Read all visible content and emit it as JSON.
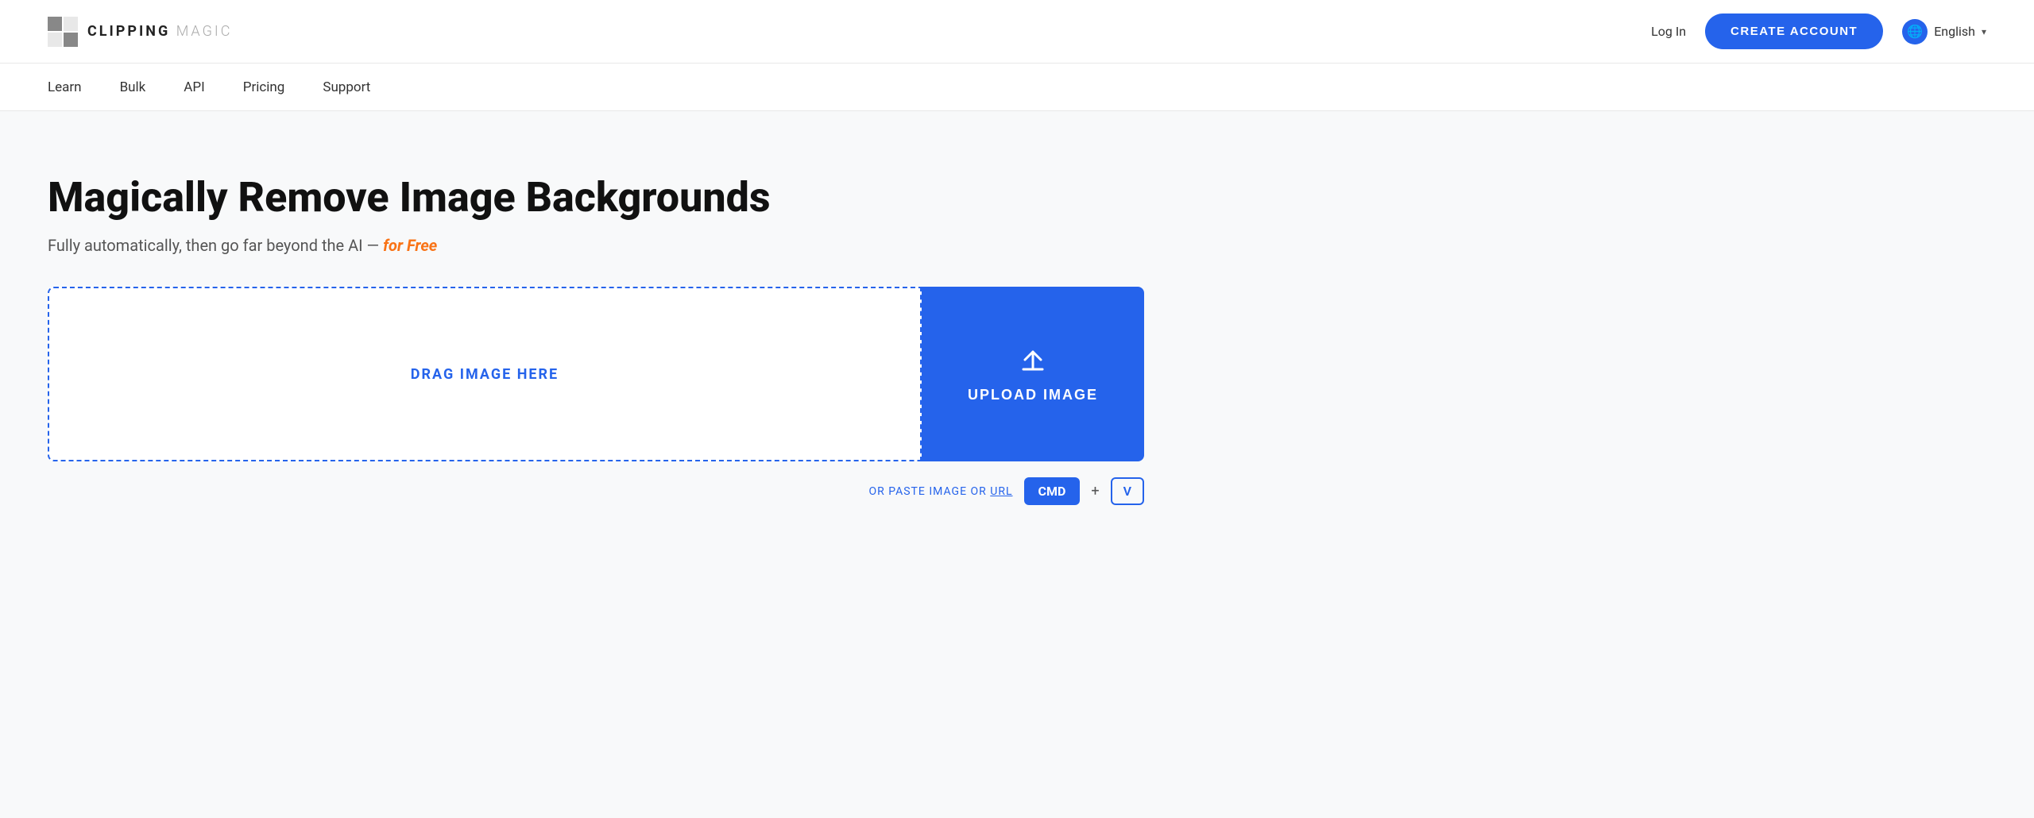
{
  "header": {
    "logo_text_clipping": "CLIPPING",
    "logo_text_magic": "MAGIC",
    "login_label": "Log In",
    "create_account_label": "CREATE ACCOUNT",
    "language_label": "English",
    "chevron": "▾"
  },
  "nav": {
    "items": [
      {
        "label": "Learn",
        "id": "learn"
      },
      {
        "label": "Bulk",
        "id": "bulk"
      },
      {
        "label": "API",
        "id": "api"
      },
      {
        "label": "Pricing",
        "id": "pricing"
      },
      {
        "label": "Support",
        "id": "support"
      }
    ]
  },
  "hero": {
    "title": "Magically Remove Image Backgrounds",
    "subtitle_plain": "Fully automatically, then go far beyond the AI —",
    "subtitle_highlight": "for Free"
  },
  "upload": {
    "drag_label": "DRAG IMAGE HERE",
    "upload_label": "UPLOAD IMAGE"
  },
  "paste": {
    "text": "OR PASTE IMAGE OR",
    "url_label": "URL",
    "cmd_label": "CMD",
    "plus_label": "+",
    "v_label": "V"
  }
}
